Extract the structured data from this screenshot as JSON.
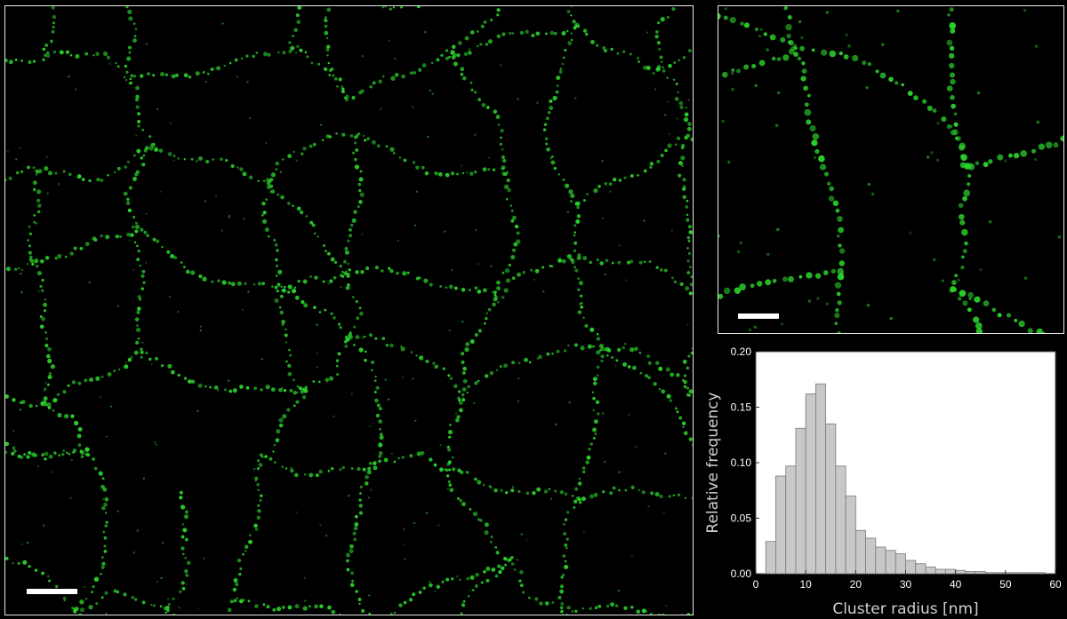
{
  "colors": {
    "background": "#000000",
    "membrane": "#2bd02b",
    "bar_fill": "#c8c8c8",
    "bar_stroke": "#7a7a7a",
    "frame": "#e8e8e8"
  },
  "images": {
    "main": {
      "description_icon": "membrane-network-micrograph",
      "has_scalebar": true
    },
    "inset": {
      "description_icon": "membrane-network-zoom-micrograph",
      "has_scalebar": true
    }
  },
  "chart_data": {
    "type": "bar",
    "title": "",
    "xlabel": "Cluster radius  [nm]",
    "ylabel": "Relative frequency",
    "xlim": [
      0,
      60
    ],
    "ylim": [
      0,
      0.2
    ],
    "xticks": [
      "0",
      "10",
      "20",
      "30",
      "40",
      "50",
      "60"
    ],
    "yticks": [
      "0.00",
      "0.05",
      "0.10",
      "0.15",
      "0.20"
    ],
    "bin_width": 2,
    "bin_starts": [
      2,
      4,
      6,
      8,
      10,
      12,
      14,
      16,
      18,
      20,
      22,
      24,
      26,
      28,
      30,
      32,
      34,
      36,
      38,
      40,
      42,
      44,
      46,
      48,
      50,
      52,
      54,
      56
    ],
    "values": [
      0.029,
      0.088,
      0.097,
      0.131,
      0.162,
      0.171,
      0.135,
      0.097,
      0.07,
      0.039,
      0.032,
      0.024,
      0.021,
      0.018,
      0.012,
      0.009,
      0.006,
      0.004,
      0.004,
      0.003,
      0.002,
      0.002,
      0.001,
      0.001,
      0.001,
      0.001,
      0.001,
      0.001
    ],
    "grid": false,
    "legend": "none"
  }
}
